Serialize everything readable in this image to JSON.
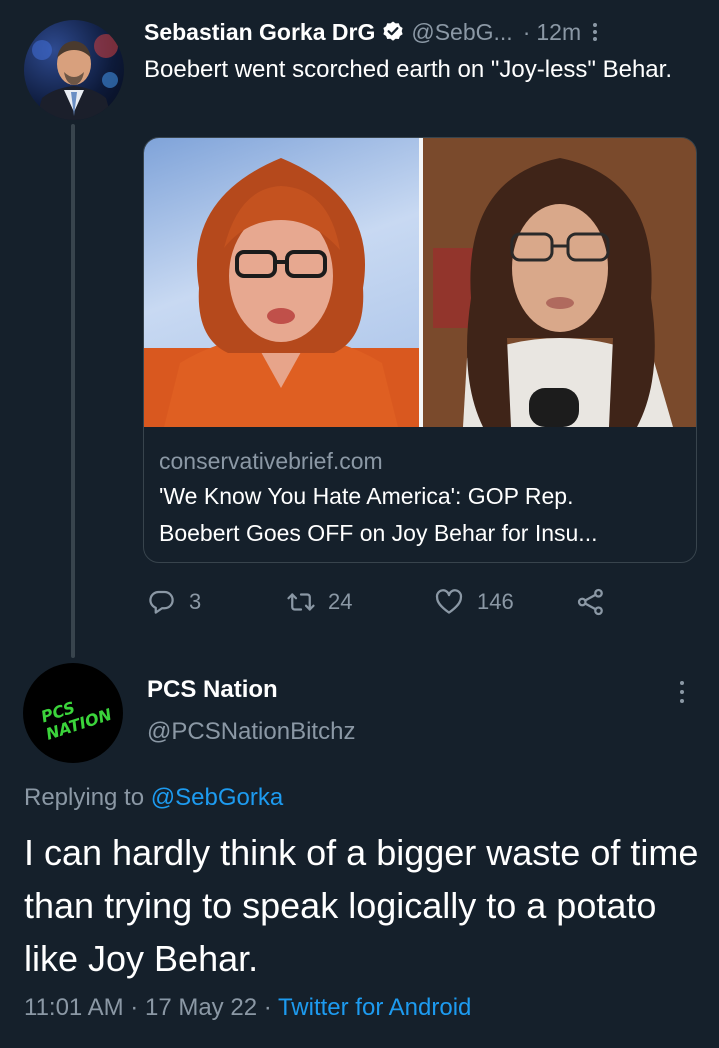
{
  "tweet": {
    "display_name": "Sebastian Gorka DrG",
    "handle": "@SebG...",
    "separator": "·",
    "time_ago": "12m",
    "text": "Boebert went scorched earth on \"Joy-less\" Behar.",
    "link_card": {
      "domain": "conservativebrief.com",
      "title": "'We Know You Hate America': GOP Rep.\nBoebert Goes OFF on Joy Behar for Insu..."
    },
    "actions": {
      "replies": "3",
      "retweets": "24",
      "likes": "146"
    }
  },
  "reply": {
    "display_name": "PCS Nation",
    "handle": "@PCSNationBitchz",
    "avatar_text": "PCS NATION",
    "replying_prefix": "Replying to",
    "replying_to": "@SebGorka",
    "text": "I can hardly think of a bigger waste of time than trying to speak logically to a potato like Joy Behar.",
    "time": "11:01 AM",
    "date": "17 May 22",
    "client": "Twitter for Android"
  },
  "colors": {
    "background": "#15202b",
    "muted": "#8b98a5",
    "accent": "#1d9bf0",
    "border": "#38444d",
    "avatar_text": "#3bd43b"
  },
  "icons": [
    "verified-badge-icon",
    "more-icon",
    "reply-icon",
    "retweet-icon",
    "like-icon",
    "share-icon"
  ]
}
